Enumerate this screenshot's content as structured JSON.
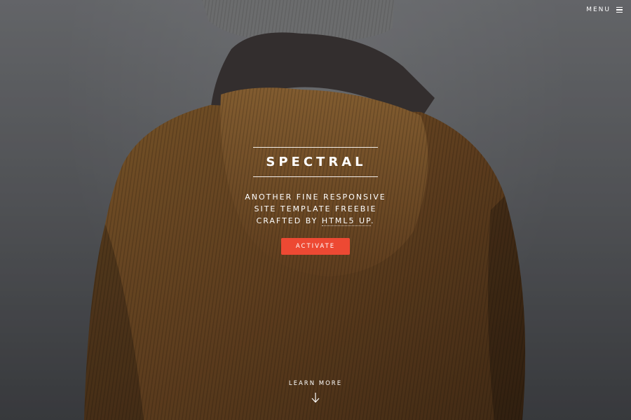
{
  "header": {
    "menu_label": "MENU",
    "menu_icon": "hamburger-icon"
  },
  "banner": {
    "title": "SPECTRAL",
    "subtitle_lines": [
      "ANOTHER FINE RESPONSIVE",
      "SITE TEMPLATE FREEBIE",
      "CRAFTED BY"
    ],
    "subtitle_link": "HTML5 UP",
    "subtitle_end": ".",
    "button_label": "ACTIVATE",
    "accent_color": "#ed4933"
  },
  "scroll": {
    "label": "LEARN MORE",
    "icon": "arrow-down-icon"
  }
}
